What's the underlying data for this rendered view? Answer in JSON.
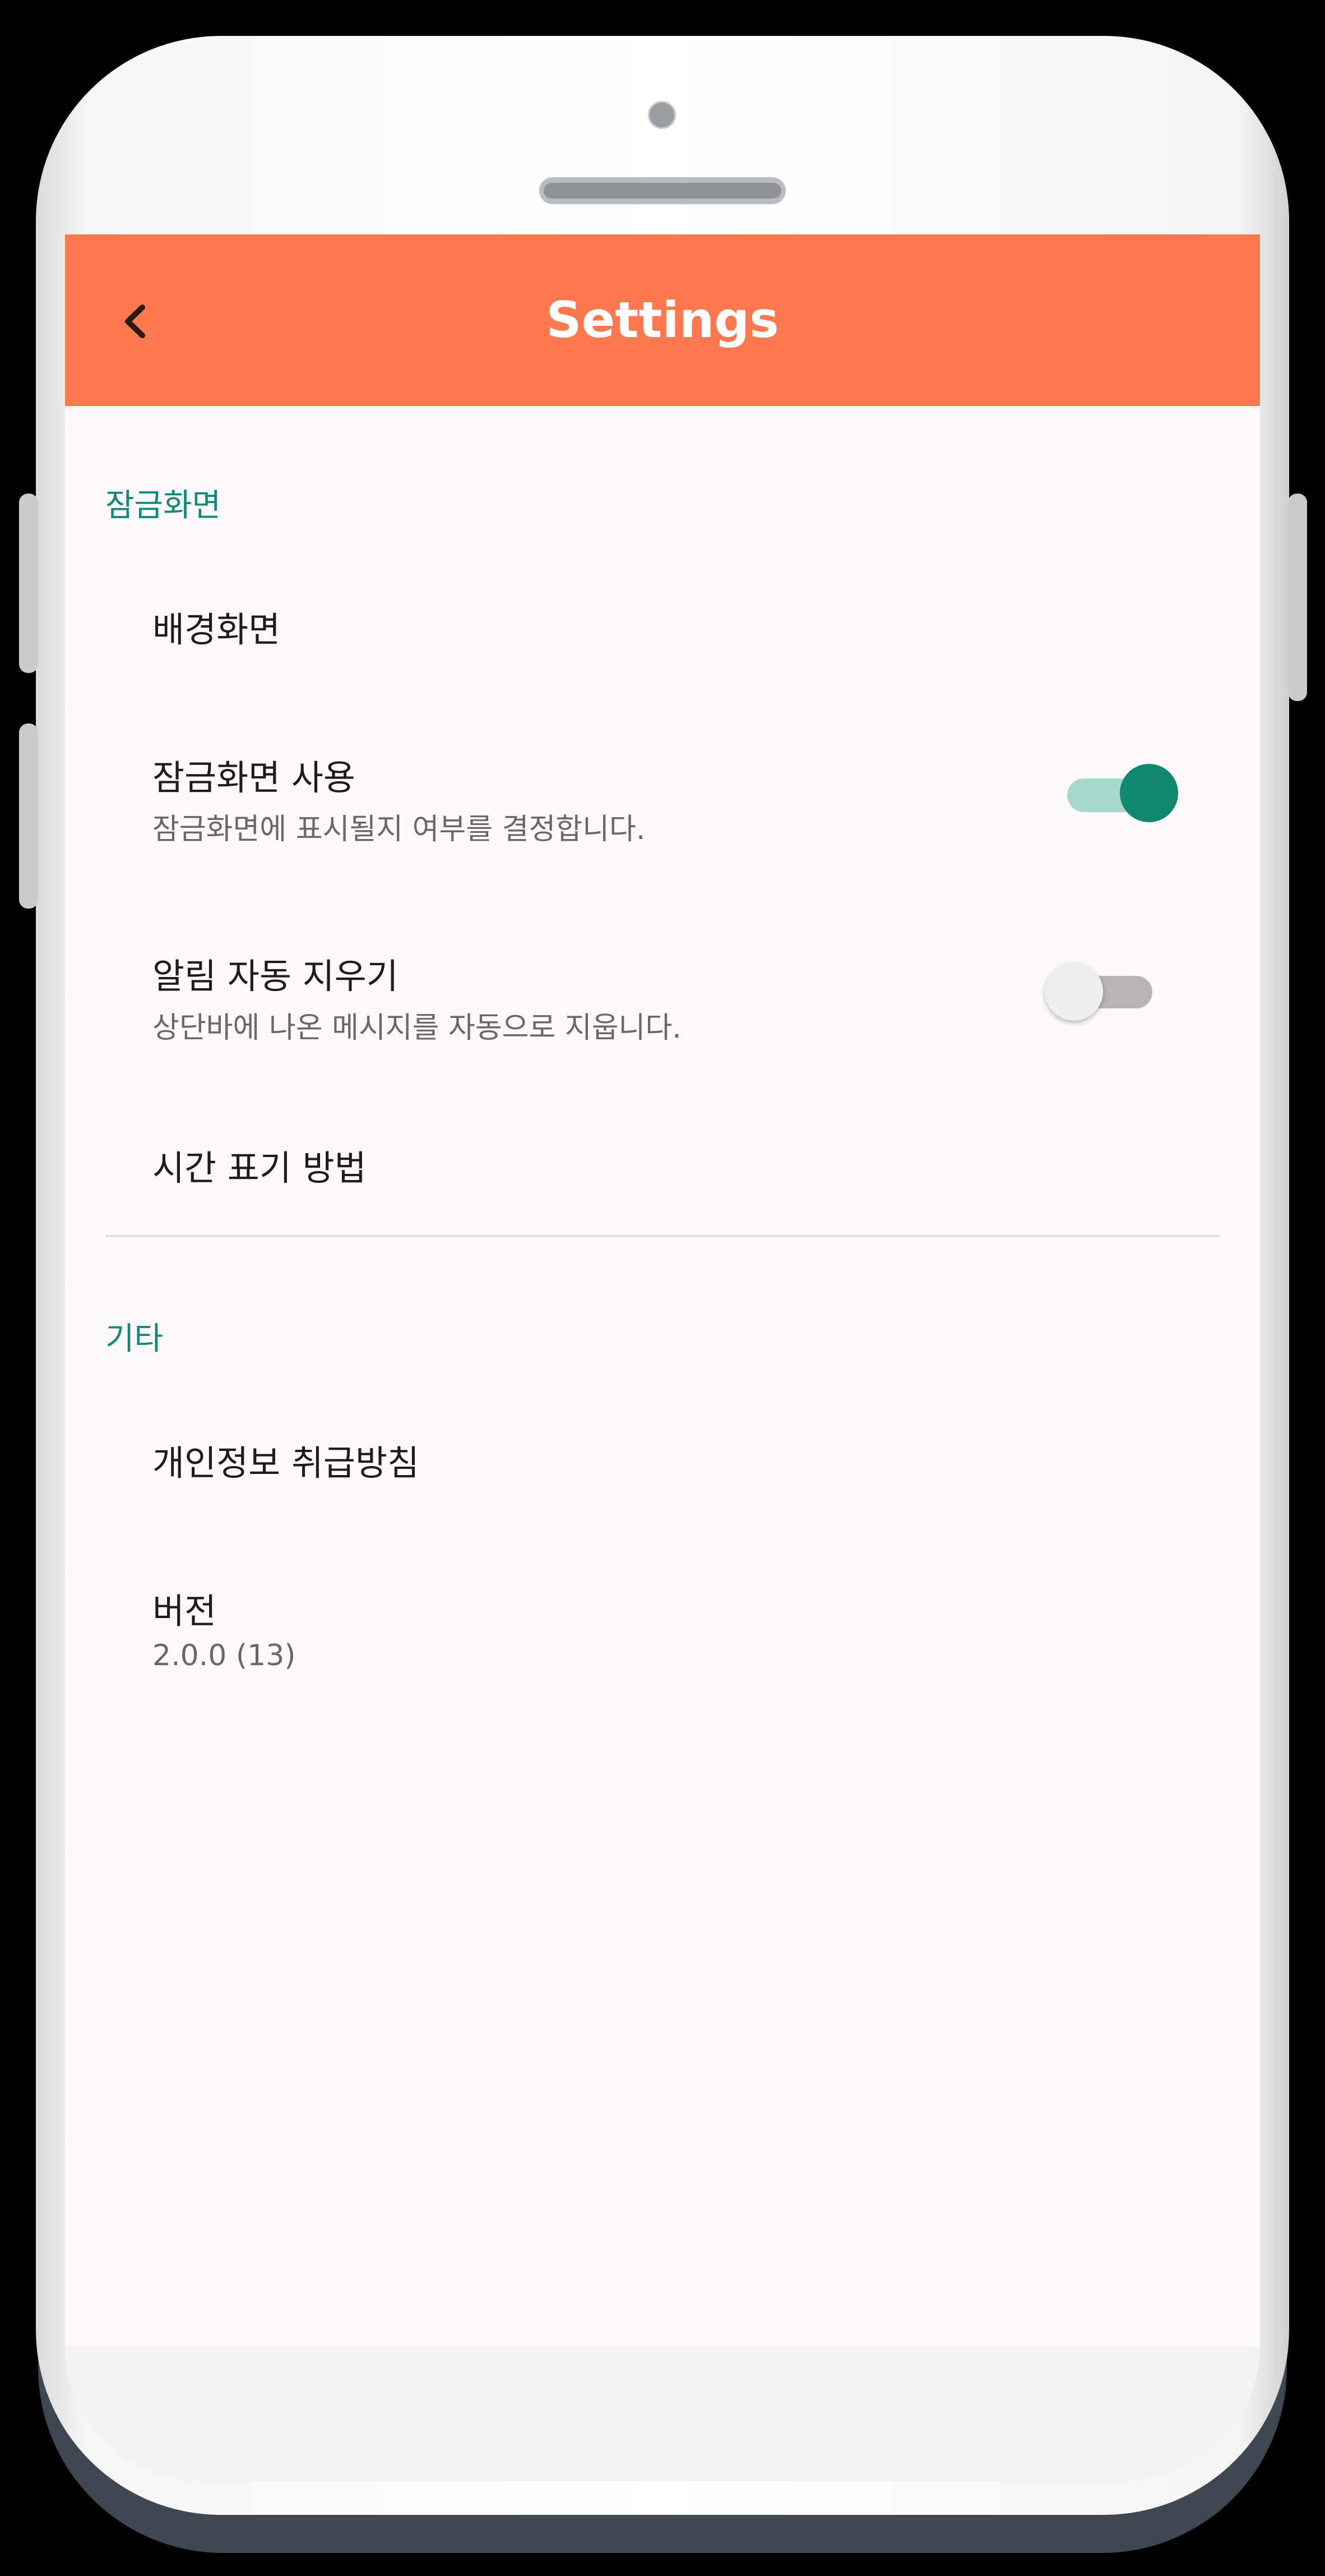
{
  "colors": {
    "app_bar": "#ff7950",
    "accent": "#0f8a74",
    "toggle_on_thumb": "#10876f",
    "toggle_on_track": "#a8d8cb",
    "toggle_off_thumb": "#eeeeee",
    "toggle_off_track": "#b7b3b6",
    "screen_bg": "#fdf8fb"
  },
  "app_bar": {
    "back_icon": "chevron-left-icon",
    "title": "Settings"
  },
  "sections": [
    {
      "header": "잠금화면",
      "items": [
        {
          "title": "배경화면"
        },
        {
          "title": "잠금화면 사용",
          "subtitle": "잠금화면에 표시될지 여부를 결정합니다.",
          "toggle": true
        },
        {
          "title": "알림 자동 지우기",
          "subtitle": "상단바에 나온 메시지를 자동으로 지웁니다.",
          "toggle": false
        },
        {
          "title": "시간 표기 방법"
        }
      ]
    },
    {
      "header": "기타",
      "items": [
        {
          "title": "개인정보 취급방침"
        },
        {
          "title": "버전",
          "subtitle": "2.0.0 (13)"
        }
      ]
    }
  ]
}
